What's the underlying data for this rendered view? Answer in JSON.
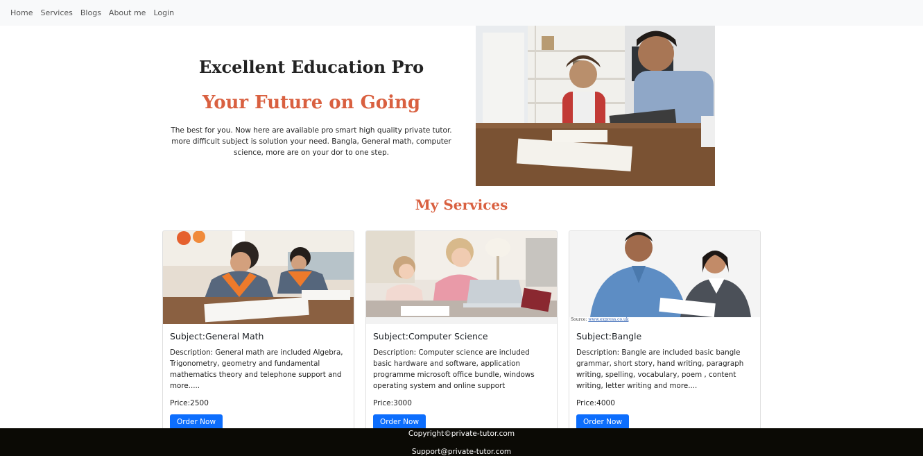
{
  "nav": {
    "items": [
      {
        "label": "Home"
      },
      {
        "label": "Services"
      },
      {
        "label": "Blogs"
      },
      {
        "label": "About me"
      },
      {
        "label": "Login"
      }
    ]
  },
  "hero": {
    "title": "Excellent Education Pro",
    "subtitle": "Your Future on Going",
    "description": "The best for you. Now here are available pro smart high quality private tutor. more difficult subject is solution your need. Bangla, General math, computer science, more are on your dor to one step."
  },
  "services": {
    "title": "My Services",
    "cards": [
      {
        "subject": "Subject:General Math",
        "description": "Description: General math are included Algebra, Trigonometry, geometry and fundamental mathematics theory and telephone support and more.....",
        "price": "Price:2500",
        "button": "Order Now"
      },
      {
        "subject": "Subject:Computer Science",
        "description": "Description: Computer science are included basic hardware and software, application programme microsoft office bundle, windows operating system and online support",
        "price": "Price:3000",
        "button": "Order Now"
      },
      {
        "subject": "Subject:Bangle",
        "description": "Description: Bangle are included basic bangle grammar, short story, hand writing, paragraph writing, spelling, vocabulary, poem , content writing, letter writing and more....",
        "price": "Price:4000",
        "button": "Order Now",
        "image_caption_prefix": "Source:",
        "image_caption_link": "www.express.co.uk"
      }
    ]
  },
  "footer": {
    "copyright": "Copyright©private-tutor.com",
    "support": "Support@private-tutor.com"
  },
  "colors": {
    "accent": "#d96040",
    "button": "#0d6efd",
    "footer_bg": "#0b0a05",
    "nav_bg": "#f8f9fa"
  }
}
